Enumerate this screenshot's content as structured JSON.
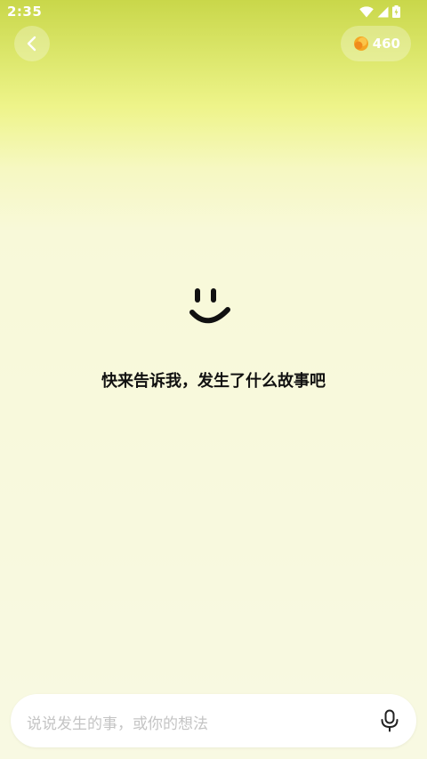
{
  "status_bar": {
    "time": "2:35"
  },
  "header": {
    "back_icon": "chevron-left-icon",
    "coin_icon": "coin-icon",
    "coin_count": "460"
  },
  "main": {
    "face_icon": "smile-face-icon",
    "prompt": "快来告诉我，发生了什么故事吧"
  },
  "input": {
    "placeholder": "说说发生的事，或你的想法",
    "mic_icon": "microphone-icon"
  },
  "colors": {
    "accent_yellow": "#dbe66a",
    "background": "#f8f9e2",
    "coin": "#f5a623"
  }
}
